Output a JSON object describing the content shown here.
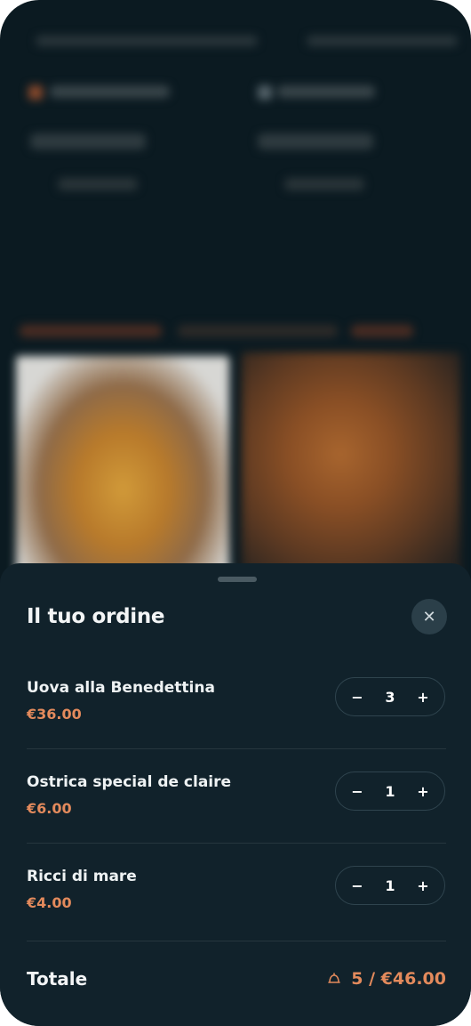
{
  "order": {
    "title": "Il tuo ordine",
    "close_icon": "close-icon",
    "items": [
      {
        "name": "Uova alla Benedettina",
        "price": "€36.00",
        "qty": "3"
      },
      {
        "name": "Ostrica special de claire",
        "price": "€6.00",
        "qty": "1"
      },
      {
        "name": "Ricci di mare",
        "price": "€4.00",
        "qty": "1"
      }
    ],
    "stepper": {
      "minus": "−",
      "plus": "+"
    },
    "total_label": "Totale",
    "total_value": "5 / €46.00",
    "total_icon": "bell-icon"
  },
  "colors": {
    "accent": "#e38a5c",
    "sheet_background": "#11222b",
    "page_background": "#0b1a21"
  }
}
